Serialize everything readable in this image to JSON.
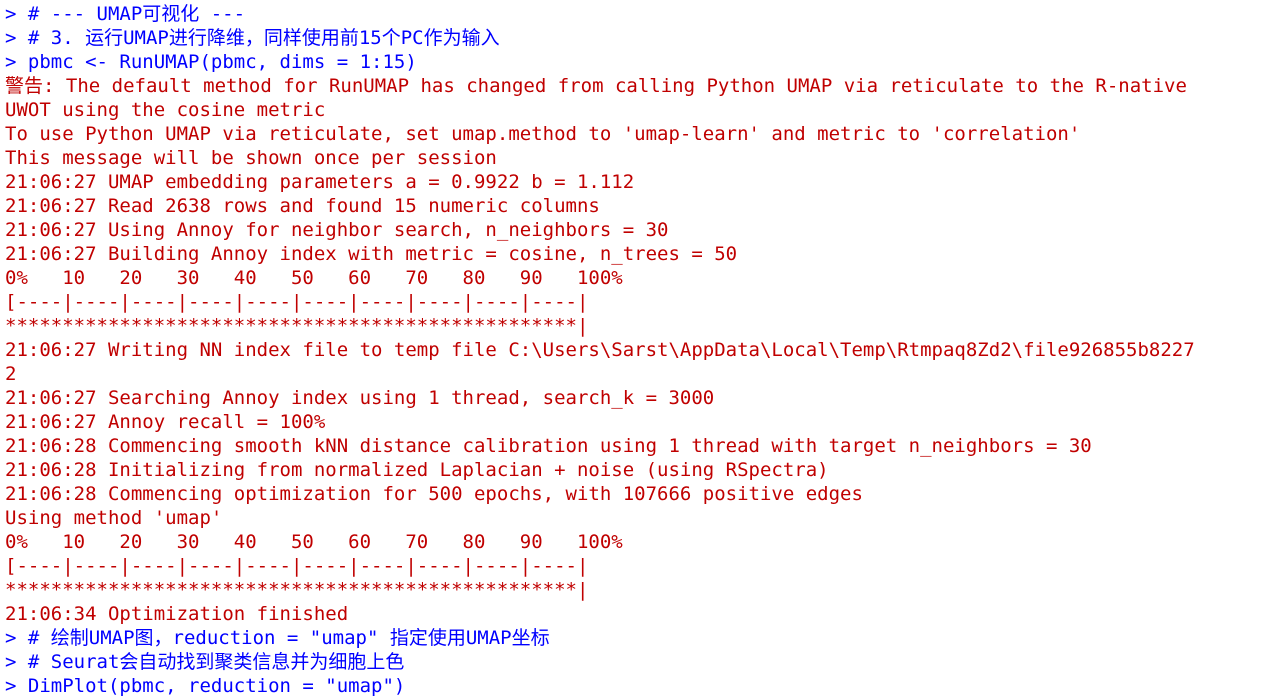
{
  "console": {
    "lines": [
      {
        "type": "cmd",
        "text": "> # --- UMAP可视化 ---"
      },
      {
        "type": "cmd",
        "text": "> # 3. 运行UMAP进行降维，同样使用前15个PC作为输入"
      },
      {
        "type": "cmd",
        "text": "> pbmc <- RunUMAP(pbmc, dims = 1:15)"
      },
      {
        "type": "out",
        "text": "警告: The default method for RunUMAP has changed from calling Python UMAP via reticulate to the R-native"
      },
      {
        "type": "out",
        "text": "UWOT using the cosine metric"
      },
      {
        "type": "out",
        "text": "To use Python UMAP via reticulate, set umap.method to 'umap-learn' and metric to 'correlation'"
      },
      {
        "type": "out",
        "text": "This message will be shown once per session"
      },
      {
        "type": "out",
        "text": "21:06:27 UMAP embedding parameters a = 0.9922 b = 1.112"
      },
      {
        "type": "out",
        "text": "21:06:27 Read 2638 rows and found 15 numeric columns"
      },
      {
        "type": "out",
        "text": "21:06:27 Using Annoy for neighbor search, n_neighbors = 30"
      },
      {
        "type": "out",
        "text": "21:06:27 Building Annoy index with metric = cosine, n_trees = 50"
      },
      {
        "type": "out",
        "text": "0%   10   20   30   40   50   60   70   80   90   100%"
      },
      {
        "type": "out",
        "text": "[----|----|----|----|----|----|----|----|----|----|"
      },
      {
        "type": "out",
        "text": "**************************************************|"
      },
      {
        "type": "out",
        "text": "21:06:27 Writing NN index file to temp file C:\\Users\\Sarst\\AppData\\Local\\Temp\\Rtmpaq8Zd2\\file926855b8227"
      },
      {
        "type": "out",
        "text": "2"
      },
      {
        "type": "out",
        "text": "21:06:27 Searching Annoy index using 1 thread, search_k = 3000"
      },
      {
        "type": "out",
        "text": "21:06:27 Annoy recall = 100%"
      },
      {
        "type": "out",
        "text": "21:06:28 Commencing smooth kNN distance calibration using 1 thread with target n_neighbors = 30"
      },
      {
        "type": "out",
        "text": "21:06:28 Initializing from normalized Laplacian + noise (using RSpectra)"
      },
      {
        "type": "out",
        "text": "21:06:28 Commencing optimization for 500 epochs, with 107666 positive edges"
      },
      {
        "type": "out",
        "text": "Using method 'umap'"
      },
      {
        "type": "out",
        "text": "0%   10   20   30   40   50   60   70   80   90   100%"
      },
      {
        "type": "out",
        "text": "[----|----|----|----|----|----|----|----|----|----|"
      },
      {
        "type": "out",
        "text": "**************************************************|"
      },
      {
        "type": "out",
        "text": "21:06:34 Optimization finished"
      },
      {
        "type": "cmd",
        "text": "> # 绘制UMAP图，reduction = \"umap\" 指定使用UMAP坐标"
      },
      {
        "type": "cmd",
        "text": "> # Seurat会自动找到聚类信息并为细胞上色"
      },
      {
        "type": "cmd",
        "text": "> DimPlot(pbmc, reduction = \"umap\")"
      }
    ]
  },
  "colors": {
    "command": "#0000ff",
    "output": "#c00000",
    "background": "#ffffff"
  }
}
